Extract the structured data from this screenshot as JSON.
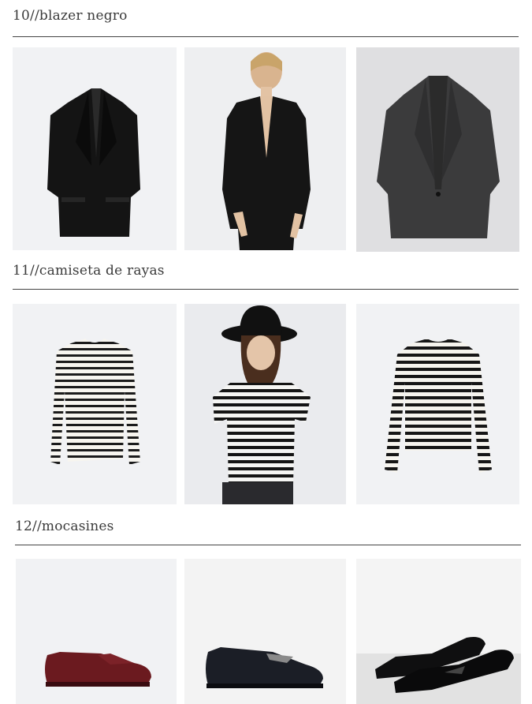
{
  "sections": [
    {
      "title": "10//blazer negro"
    },
    {
      "title": "11//camiseta de rayas"
    },
    {
      "title": "12//mocasines"
    }
  ],
  "images": {
    "blazer": [
      "black blazer product shot",
      "model wearing black blazer",
      "dark grey blazer product shot"
    ],
    "tee": [
      "striped long sleeve tee product shot",
      "model in striped tee and black hat",
      "striped long sleeve tee flat"
    ],
    "shoes": [
      "burgundy loafer",
      "black loafer with chain",
      "black patent loafers pair"
    ]
  },
  "colors": {
    "rule": "#444444",
    "title": "#3a3a3a",
    "photo_bg_light": "#f1f2f4",
    "photo_bg_grey": "#dfdfe1"
  }
}
